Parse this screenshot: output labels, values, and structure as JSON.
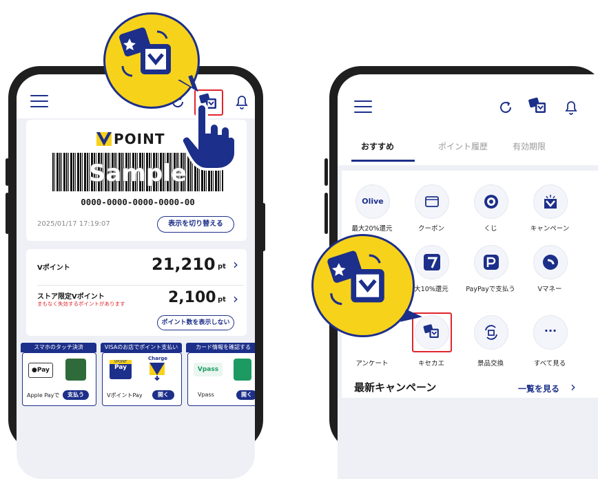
{
  "left_phone": {
    "logo_v": "V",
    "logo_text": "POINT",
    "barcode_overlay": "Sample",
    "card_number": "0000-0000-0000-0000-00",
    "timestamp": "2025/01/17 17:19:07",
    "toggle_display_button": "表示を切り替える",
    "vpoint_label": "Vポイント",
    "vpoint_value": "21,210",
    "pt_unit": "pt",
    "store_label": "ストア限定Vポイント",
    "store_warning": "まもなく失効するポイントがあります",
    "store_value": "2,100",
    "hide_points_button": "ポイント数を表示しない",
    "promo_tabs": [
      "スマホのタッチ決済",
      "VISAのお店でポイント支払い",
      "カード情報を確認する"
    ],
    "applepay_badge": "Pay",
    "applepay_caption": "Apple Payで",
    "applepay_button": "支払う",
    "vpointpay_badge_top": "VPOINT",
    "vpointpay_badge": "Pay",
    "charge_label": "Charge",
    "vpointpay_caption": "VポイントPay",
    "vpointpay_button": "開く",
    "vpass_badge": "Vpass",
    "vpass_caption": "Vpass",
    "vpass_button": "開く"
  },
  "right_phone": {
    "tabs": [
      "おすすめ",
      "ポイント履歴",
      "有効期限"
    ],
    "row1": [
      {
        "icon": "olive-logo",
        "text": "Olive",
        "label": "最大20%還元"
      },
      {
        "icon": "coupon-icon",
        "label": "クーポン"
      },
      {
        "icon": "lottery-target-icon",
        "label": "くじ"
      },
      {
        "icon": "campaign-icon",
        "label": "キャンペーン"
      }
    ],
    "row2": [
      {
        "icon": "seven-eleven-icon",
        "label": "大10%還元"
      },
      {
        "icon": "paypay-icon",
        "label": "PayPayで支払う"
      },
      {
        "icon": "vmoney-icon",
        "label": "Vマネー"
      }
    ],
    "row3": [
      {
        "icon": "survey-icon",
        "label": "アンケート"
      },
      {
        "icon": "kisekae-icon",
        "label": "キセカエ"
      },
      {
        "icon": "prize-exchange-icon",
        "label": "景品交換"
      },
      {
        "icon": "more-icon",
        "text": "···",
        "label": "すべて見る"
      }
    ],
    "section_title": "最新キャンペーン",
    "see_all_link": "一覧を見る",
    "see_all_chevron": "›"
  },
  "colors": {
    "navy": "#1c2f8a",
    "yellow": "#f7d21a",
    "red": "#e0242c"
  }
}
